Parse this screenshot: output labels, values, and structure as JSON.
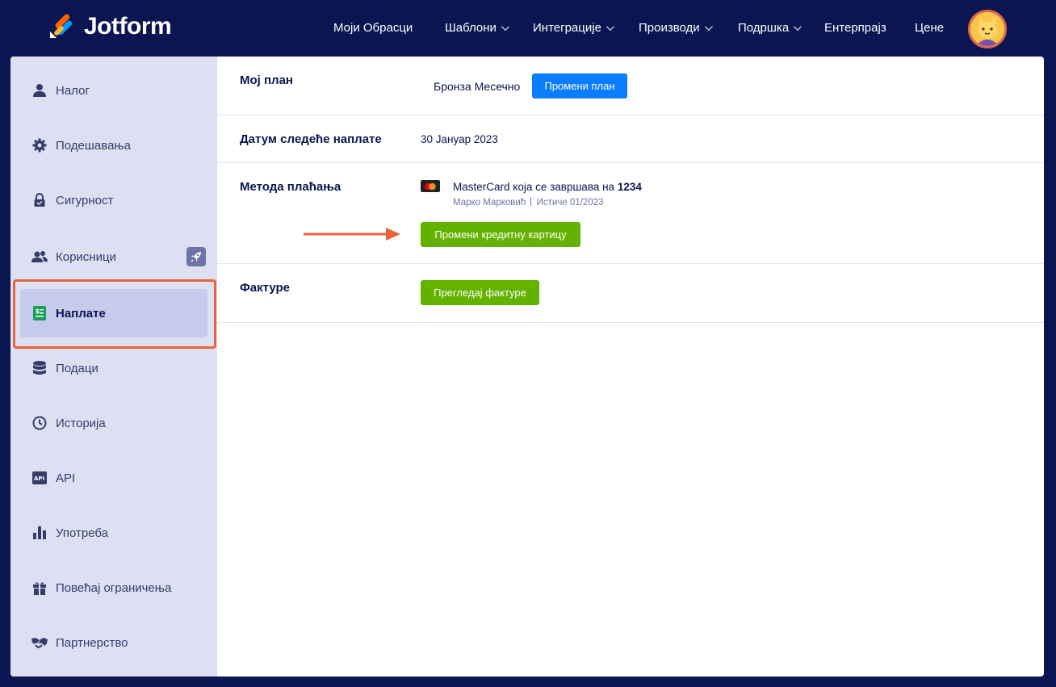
{
  "brand": {
    "name": "Jotform"
  },
  "nav": {
    "items": [
      {
        "label": "Моји Обрасци",
        "dropdown": false
      },
      {
        "label": "Шаблони",
        "dropdown": true
      },
      {
        "label": "Интеграције",
        "dropdown": true
      },
      {
        "label": "Производи",
        "dropdown": true
      },
      {
        "label": "Подршка",
        "dropdown": true
      },
      {
        "label": "Ентерпрајз",
        "dropdown": false
      },
      {
        "label": "Цене",
        "dropdown": false
      }
    ]
  },
  "sidebar": {
    "items": [
      {
        "label": "Налог",
        "icon": "user-icon"
      },
      {
        "label": "Подешавања",
        "icon": "gear-icon"
      },
      {
        "label": "Сигурност",
        "icon": "lock-icon"
      },
      {
        "label": "Корисници",
        "icon": "users-icon",
        "badge": "rocket-icon"
      },
      {
        "label": "Наплате",
        "icon": "billing-icon",
        "active": true
      },
      {
        "label": "Подаци",
        "icon": "database-icon"
      },
      {
        "label": "Историја",
        "icon": "history-icon"
      },
      {
        "label": "API",
        "icon": "api-icon"
      },
      {
        "label": "Употреба",
        "icon": "bar-chart-icon"
      },
      {
        "label": "Повећај ограничења",
        "icon": "gift-icon"
      },
      {
        "label": "Партнерство",
        "icon": "handshake-icon"
      }
    ]
  },
  "billing": {
    "plan": {
      "title": "Мој план",
      "value": "Бронза Месечно",
      "button": "Промени план"
    },
    "next_charge": {
      "title": "Датум следеће наплате",
      "value": "30 Јануар 2023"
    },
    "payment": {
      "title": "Метода плаћања",
      "card_text": "MasterCard која се завршава на ",
      "card_last4": "1234",
      "holder": "Марко Марковић",
      "expires": "Истиче 01/2023",
      "button": "Промени кредитну картицу"
    },
    "invoices": {
      "title": "Фактуре",
      "button": "Прегледај фактуре"
    }
  },
  "colors": {
    "nav_bg": "#0a1551",
    "sidebar_bg": "#dde0f3",
    "active_bg": "#c6cbed",
    "primary_blue": "#0a7cff",
    "green": "#64b200",
    "highlight": "#e8643a"
  }
}
